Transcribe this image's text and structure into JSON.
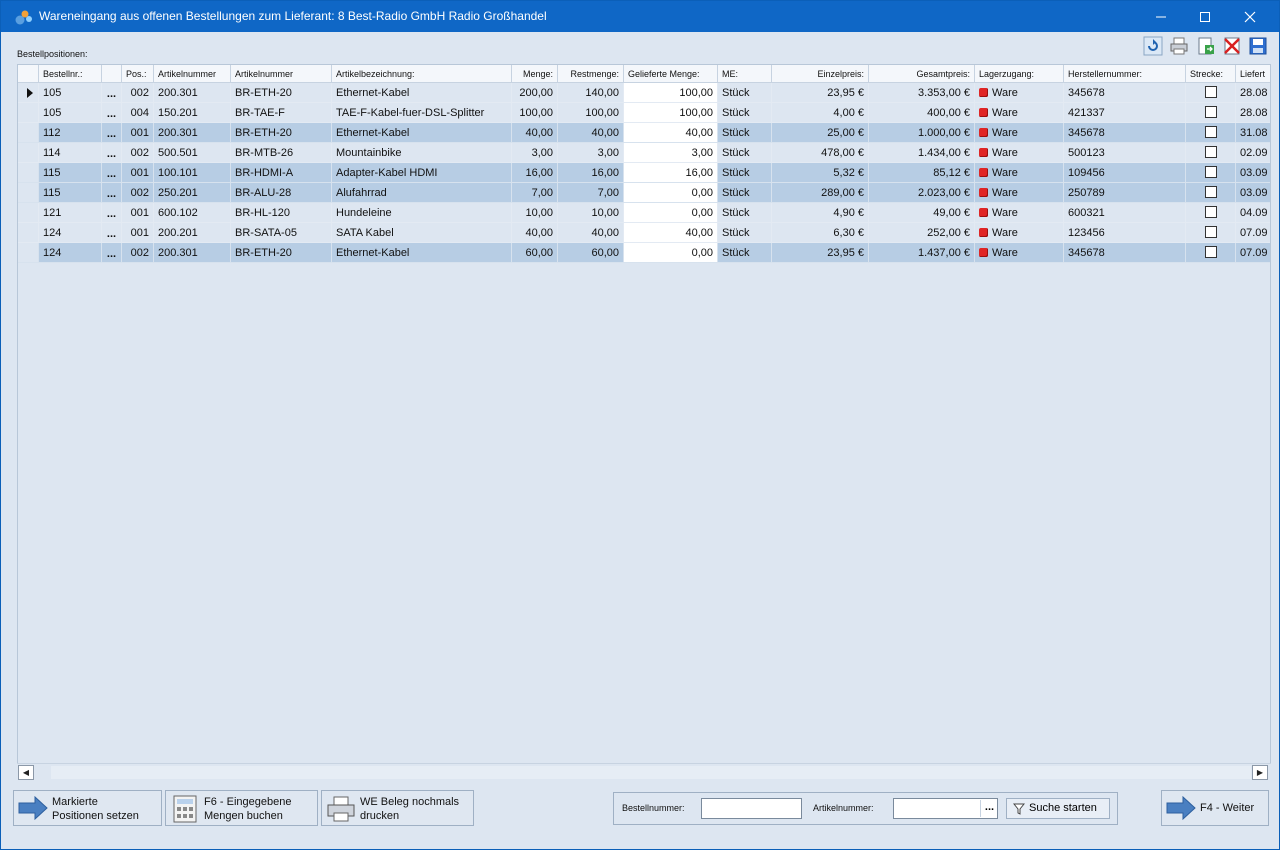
{
  "window": {
    "title": "Wareneingang aus offenen Bestellungen zum Lieferant: 8 Best-Radio GmbH Radio Großhandel",
    "min_icon": "minimize-icon",
    "max_icon": "maximize-icon",
    "close_icon": "close-icon"
  },
  "section_label": "Bestellpositionen:",
  "toolbar": [
    "refresh-icon",
    "print-icon",
    "export-icon",
    "delete-icon",
    "save-icon"
  ],
  "columns": [
    "Bestellnr.:",
    "",
    "Pos.:",
    "Artikelnummer",
    "Artikelnummer",
    "Artikelbezeichnung:",
    "Menge:",
    "Restmenge:",
    "Gelieferte Menge:",
    "ME:",
    "Einzelpreis:",
    "Gesamtpreis:",
    "Lagerzugang:",
    "Herstellernummer:",
    "Strecke:",
    "Liefert"
  ],
  "rows": [
    {
      "bestellnr": "105",
      "dots": "...",
      "pos": "002",
      "artnr1": "200.301",
      "artnr2": "BR-ETH-20",
      "bez": "Ethernet-Kabel",
      "menge": "200,00",
      "rest": "140,00",
      "geliefert": "100,00",
      "me": "Stück",
      "einzel": "23,95 €",
      "gesamt": "3.353,00 €",
      "lager": "Ware",
      "hersteller": "345678",
      "liefer": "28.08",
      "highlight": false,
      "current": true
    },
    {
      "bestellnr": "105",
      "dots": "...",
      "pos": "004",
      "artnr1": "150.201",
      "artnr2": "BR-TAE-F",
      "bez": "TAE-F-Kabel-fuer-DSL-Splitter",
      "menge": "100,00",
      "rest": "100,00",
      "geliefert": "100,00",
      "me": "Stück",
      "einzel": "4,00 €",
      "gesamt": "400,00 €",
      "lager": "Ware",
      "hersteller": "421337",
      "liefer": "28.08",
      "highlight": false,
      "current": false
    },
    {
      "bestellnr": "112",
      "dots": "...",
      "pos": "001",
      "artnr1": "200.301",
      "artnr2": "BR-ETH-20",
      "bez": "Ethernet-Kabel",
      "menge": "40,00",
      "rest": "40,00",
      "geliefert": "40,00",
      "me": "Stück",
      "einzel": "25,00 €",
      "gesamt": "1.000,00 €",
      "lager": "Ware",
      "hersteller": "345678",
      "liefer": "31.08",
      "highlight": true,
      "current": false
    },
    {
      "bestellnr": "114",
      "dots": "...",
      "pos": "002",
      "artnr1": "500.501",
      "artnr2": "BR-MTB-26",
      "bez": "Mountainbike",
      "menge": "3,00",
      "rest": "3,00",
      "geliefert": "3,00",
      "me": "Stück",
      "einzel": "478,00 €",
      "gesamt": "1.434,00 €",
      "lager": "Ware",
      "hersteller": "500123",
      "liefer": "02.09",
      "highlight": false,
      "current": false
    },
    {
      "bestellnr": "115",
      "dots": "...",
      "pos": "001",
      "artnr1": "100.101",
      "artnr2": "BR-HDMI-A",
      "bez": "Adapter-Kabel HDMI",
      "menge": "16,00",
      "rest": "16,00",
      "geliefert": "16,00",
      "me": "Stück",
      "einzel": "5,32 €",
      "gesamt": "85,12 €",
      "lager": "Ware",
      "hersteller": "109456",
      "liefer": "03.09",
      "highlight": true,
      "current": false
    },
    {
      "bestellnr": "115",
      "dots": "...",
      "pos": "002",
      "artnr1": "250.201",
      "artnr2": "BR-ALU-28",
      "bez": "Alufahrrad",
      "menge": "7,00",
      "rest": "7,00",
      "geliefert": "0,00",
      "me": "Stück",
      "einzel": "289,00 €",
      "gesamt": "2.023,00 €",
      "lager": "Ware",
      "hersteller": "250789",
      "liefer": "03.09",
      "highlight": true,
      "current": false
    },
    {
      "bestellnr": "121",
      "dots": "...",
      "pos": "001",
      "artnr1": "600.102",
      "artnr2": "BR-HL-120",
      "bez": "Hundeleine",
      "menge": "10,00",
      "rest": "10,00",
      "geliefert": "0,00",
      "me": "Stück",
      "einzel": "4,90 €",
      "gesamt": "49,00 €",
      "lager": "Ware",
      "hersteller": "600321",
      "liefer": "04.09",
      "highlight": false,
      "current": false
    },
    {
      "bestellnr": "124",
      "dots": "...",
      "pos": "001",
      "artnr1": "200.201",
      "artnr2": "BR-SATA-05",
      "bez": "SATA Kabel",
      "menge": "40,00",
      "rest": "40,00",
      "geliefert": "40,00",
      "me": "Stück",
      "einzel": "6,30 €",
      "gesamt": "252,00 €",
      "lager": "Ware",
      "hersteller": "123456",
      "liefer": "07.09",
      "highlight": false,
      "current": false
    },
    {
      "bestellnr": "124",
      "dots": "...",
      "pos": "002",
      "artnr1": "200.301",
      "artnr2": "BR-ETH-20",
      "bez": "Ethernet-Kabel",
      "menge": "60,00",
      "rest": "60,00",
      "geliefert": "0,00",
      "me": "Stück",
      "einzel": "23,95 €",
      "gesamt": "1.437,00 €",
      "lager": "Ware",
      "hersteller": "345678",
      "liefer": "07.09",
      "highlight": true,
      "current": false
    }
  ],
  "buttons": {
    "mark_line1": "Markierte",
    "mark_line2": "Positionen setzen",
    "book_line1": "F6 - Eingegebene",
    "book_line2": "Mengen buchen",
    "print_line1": "WE Beleg nochmals",
    "print_line2": "drucken",
    "next": "F4 - Weiter"
  },
  "search": {
    "order_label": "Bestellnummer:",
    "order_value": "",
    "article_label": "Artikelnummer:",
    "article_value": "",
    "article_dots": "...",
    "start": "Suche starten"
  },
  "colors": {
    "titlebar": "#0f67c6",
    "row_highlight": "#b7cde4",
    "background": "#dde6f1",
    "status_red": "#e02525"
  }
}
